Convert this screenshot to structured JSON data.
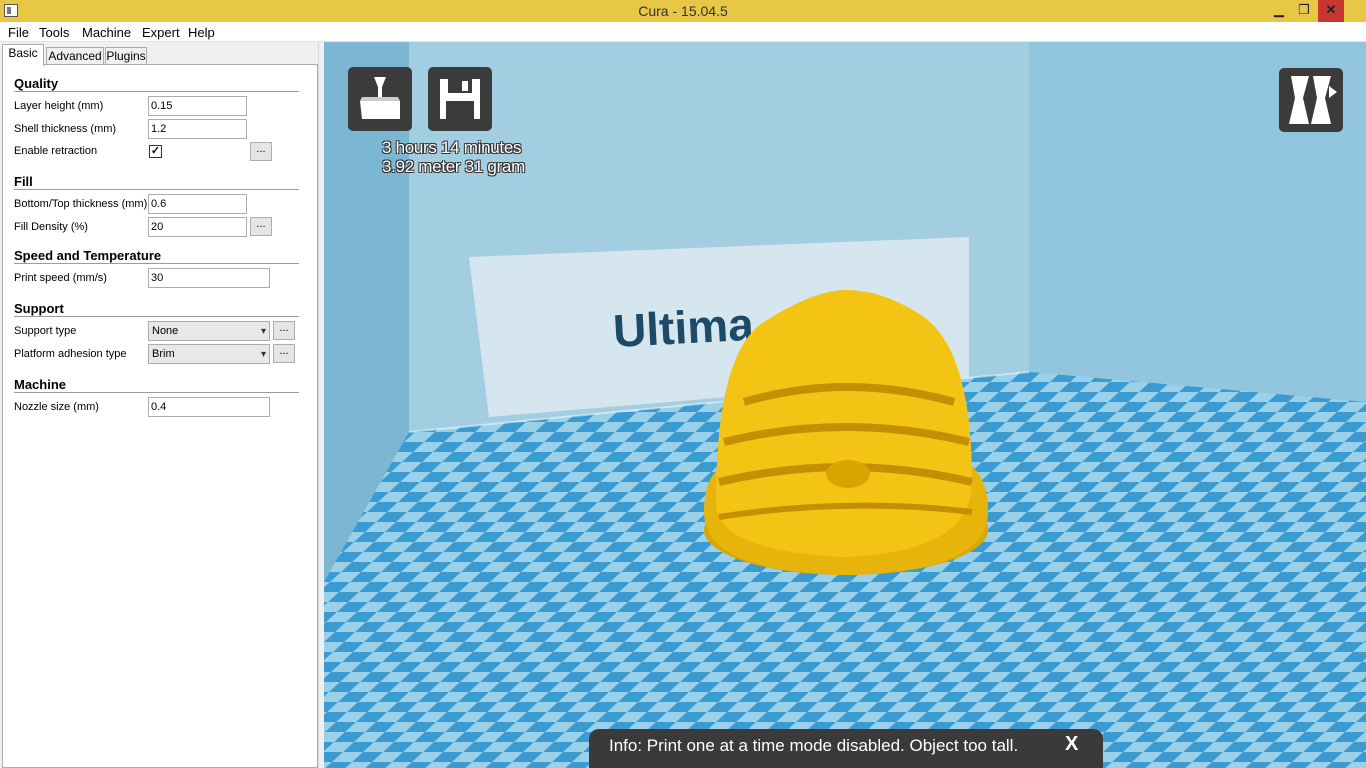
{
  "window": {
    "title": "Cura - 15.04.5",
    "minimize_glyph": "▁",
    "maximize_glyph": "❐",
    "close_glyph": "✕"
  },
  "menu": [
    "File",
    "Tools",
    "Machine",
    "Expert",
    "Help"
  ],
  "tabs": [
    "Basic",
    "Advanced",
    "Plugins"
  ],
  "sections": {
    "quality": {
      "title": "Quality",
      "layer_height_label": "Layer height (mm)",
      "layer_height_value": "0.15",
      "shell_thickness_label": "Shell thickness (mm)",
      "shell_thickness_value": "1.2",
      "retraction_label": "Enable retraction",
      "retraction_checked": "✓"
    },
    "fill": {
      "title": "Fill",
      "bottom_top_label": "Bottom/Top thickness (mm)",
      "bottom_top_value": "0.6",
      "density_label": "Fill Density (%)",
      "density_value": "20"
    },
    "speed": {
      "title": "Speed and Temperature",
      "print_speed_label": "Print speed (mm/s)",
      "print_speed_value": "30"
    },
    "support": {
      "title": "Support",
      "support_type_label": "Support type",
      "support_type_value": "None",
      "adhesion_label": "Platform adhesion type",
      "adhesion_value": "Brim"
    },
    "machine": {
      "title": "Machine",
      "nozzle_label": "Nozzle size (mm)",
      "nozzle_value": "0.4"
    }
  },
  "ellipsis": "...",
  "dropdown_arrow": "▾",
  "viewport": {
    "print_time": "3 hours 14 minutes",
    "print_material": "3.92 meter 31 gram",
    "backdrop_text": "Ultima",
    "info_message": "Info: Print one at a time mode disabled. Object too tall.",
    "info_close": "X",
    "model_color": "#f4c414",
    "bed_light": "#9bd0e9",
    "bed_dark": "#3a9ad2",
    "wall_color": "#7fbcd8"
  }
}
